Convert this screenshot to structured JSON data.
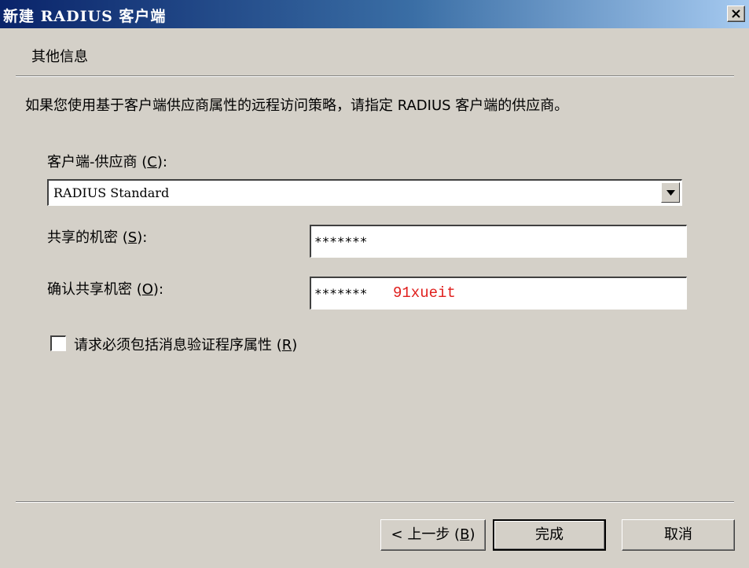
{
  "window": {
    "title": "新建 RADIUS 客户端"
  },
  "header": {
    "section_title": "其他信息"
  },
  "description": "如果您使用基于客户端供应商属性的远程访问策略，请指定 RADIUS 客户端的供应商。",
  "vendor": {
    "label": "客户端-供应商",
    "hotkey": "C",
    "value": "RADIUS Standard"
  },
  "shared_secret": {
    "label": "共享的机密",
    "hotkey": "S",
    "value": "*******"
  },
  "confirm_secret": {
    "label": "确认共享机密",
    "hotkey": "O",
    "value": "*******"
  },
  "watermark": "91xueit",
  "message_auth": {
    "label": "请求必须包括消息验证程序属性",
    "hotkey": "R",
    "checked": false
  },
  "buttons": {
    "back_label": "< 上一步",
    "back_hotkey": "B",
    "finish_label": "完成",
    "cancel_label": "取消"
  }
}
